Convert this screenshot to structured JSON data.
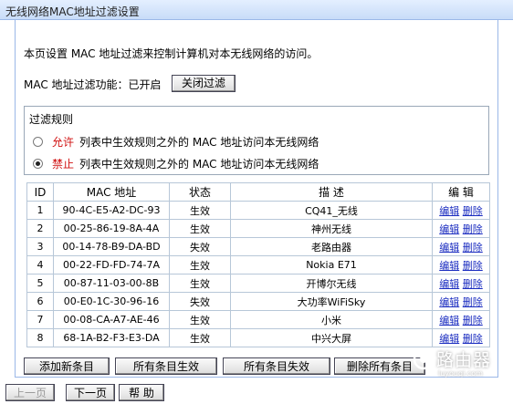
{
  "window": {
    "title": "无线网络MAC地址过滤设置"
  },
  "page": {
    "description": "本页设置 MAC 地址过滤来控制计算机对本无线网络的访问。",
    "status_label": "MAC 地址过滤功能：已开启",
    "toggle_button": "关闭过滤"
  },
  "rules": {
    "legend": "过滤规则",
    "allow": {
      "keyword": "允许",
      "text": "列表中生效规则之外的 MAC 地址访问本无线网络",
      "selected": false
    },
    "deny": {
      "keyword": "禁止",
      "text": "列表中生效规则之外的 MAC 地址访问本无线网络",
      "selected": true
    }
  },
  "table": {
    "headers": {
      "id": "ID",
      "mac": "MAC 地址",
      "status": "状态",
      "desc": "描 述",
      "edit": "编 辑"
    },
    "edit_label": "编辑",
    "delete_label": "删除",
    "rows": [
      {
        "id": "1",
        "mac": "90-4C-E5-A2-DC-93",
        "status": "生效",
        "desc": "CQ41_无线"
      },
      {
        "id": "2",
        "mac": "00-25-86-19-8A-4A",
        "status": "生效",
        "desc": "神州无线"
      },
      {
        "id": "3",
        "mac": "00-14-78-B9-DA-BD",
        "status": "失效",
        "desc": "老路由器"
      },
      {
        "id": "4",
        "mac": "00-22-FD-FD-74-7A",
        "status": "生效",
        "desc": "Nokia E71"
      },
      {
        "id": "5",
        "mac": "00-87-11-03-00-8B",
        "status": "生效",
        "desc": "开博尔无线"
      },
      {
        "id": "6",
        "mac": "00-E0-1C-30-96-16",
        "status": "失效",
        "desc": "大功率WiFiSky"
      },
      {
        "id": "7",
        "mac": "00-08-CA-A7-AE-46",
        "status": "生效",
        "desc": "小米"
      },
      {
        "id": "8",
        "mac": "68-1A-B2-F3-E3-DA",
        "status": "生效",
        "desc": "中兴大屏"
      }
    ]
  },
  "actions": {
    "add": "添加新条目",
    "enable_all": "所有条目生效",
    "disable_all": "所有条目失效",
    "delete_all": "删除所有条目"
  },
  "nav": {
    "prev": "上一页",
    "next": "下一页",
    "help": "帮 助"
  },
  "watermark": {
    "brand": "路由器",
    "domain": "luyouqi.com",
    "icon": "router-logo-icon"
  }
}
